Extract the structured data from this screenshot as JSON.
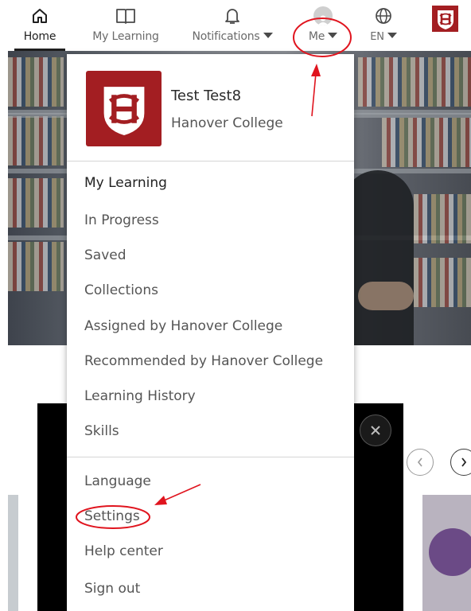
{
  "nav": {
    "home": "Home",
    "my_learning": "My Learning",
    "notifications": "Notifications",
    "me": "Me",
    "language": "EN"
  },
  "profile": {
    "name": "Test Test8",
    "organization": "Hanover College"
  },
  "menu": {
    "section_label": "My Learning",
    "items": [
      "In Progress",
      "Saved",
      "Collections",
      "Assigned by Hanover College",
      "Recommended by Hanover College",
      "Learning History",
      "Skills"
    ],
    "account_items": [
      "Language",
      "Settings",
      "Help center",
      "Sign out"
    ]
  },
  "colors": {
    "brand": "#a31e22",
    "annotation": "#e0141e"
  },
  "icons": [
    "home-icon",
    "book-icon",
    "bell-icon",
    "avatar-icon",
    "globe-icon",
    "close-icon",
    "chevron-left-icon",
    "chevron-right-icon"
  ]
}
